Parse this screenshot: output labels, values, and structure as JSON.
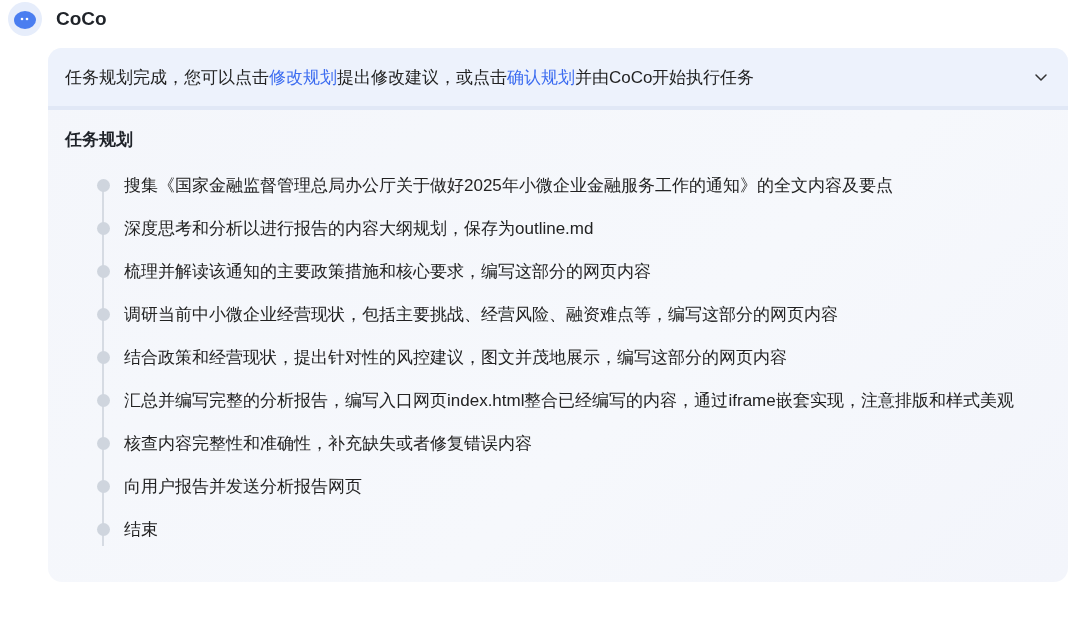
{
  "assistant": {
    "name": "CoCo"
  },
  "plan_card": {
    "expanded": true,
    "message": [
      {
        "kind": "text",
        "text": "任务规划完成，您可以点击"
      },
      {
        "kind": "link",
        "text": "修改规划"
      },
      {
        "kind": "text",
        "text": "提出修改建议，或点击"
      },
      {
        "kind": "link",
        "text": "确认规划"
      },
      {
        "kind": "text",
        "text": "并由CoCo开始执行任务"
      }
    ],
    "title": "任务规划",
    "steps": [
      "搜集《国家金融监督管理总局办公厅关于做好2025年小微企业金融服务工作的通知》的全文内容及要点",
      "深度思考和分析以进行报告的内容大纲规划，保存为outline.md",
      "梳理并解读该通知的主要政策措施和核心要求，编写这部分的网页内容",
      "调研当前中小微企业经营现状，包括主要挑战、经营风险、融资难点等，编写这部分的网页内容",
      "结合政策和经营现状，提出针对性的风控建议，图文并茂地展示，编写这部分的网页内容",
      "汇总并编写完整的分析报告，编写入口网页index.html整合已经编写的内容，通过iframe嵌套实现，注意排版和样式美观",
      "核查内容完整性和准确性，补充缺失或者修复错误内容",
      "向用户报告并发送分析报告网页",
      "结束"
    ]
  }
}
